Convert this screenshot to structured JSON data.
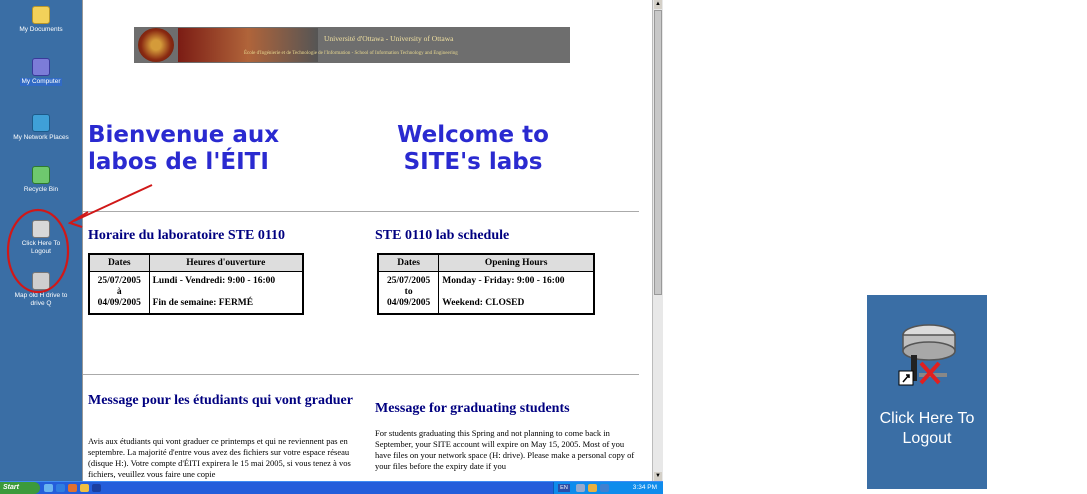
{
  "desktop": {
    "icons": [
      {
        "label": "My Documents"
      },
      {
        "label": "My Computer"
      },
      {
        "label": "My Network Places"
      },
      {
        "label": "Recycle Bin"
      },
      {
        "label": "Click Here To Logout"
      },
      {
        "label": "Map old H drive to drive Q"
      }
    ]
  },
  "banner": {
    "title": "Université d'Ottawa - University of Ottawa",
    "subtitle": "École d'Ingénierie et de Technologie de l'Information - School of Information Technology and Engineering"
  },
  "welcome": {
    "fr_line1": "Bienvenue aux",
    "fr_line2": "labos de l'ÉITI",
    "en_line1": "Welcome to",
    "en_line2": "SITE's labs"
  },
  "schedule_fr": {
    "heading": "Horaire du laboratoire STE 0110",
    "col_dates": "Dates",
    "col_hours": "Heures d'ouverture",
    "date_from": "25/07/2005",
    "date_sep": "à",
    "date_to": "04/09/2005",
    "hours_week": "Lundi - Vendredi: 9:00 - 16:00",
    "hours_weekend": "Fin de semaine: FERMÉ"
  },
  "schedule_en": {
    "heading": "STE 0110 lab schedule",
    "col_dates": "Dates",
    "col_hours": "Opening Hours",
    "date_from": "25/07/2005",
    "date_sep": "to",
    "date_to": "04/09/2005",
    "hours_week": "Monday - Friday: 9:00 - 16:00",
    "hours_weekend": "Weekend: CLOSED"
  },
  "graduating_fr": {
    "heading": "Message pour les étudiants qui vont graduer",
    "body": "Avis aux étudiants qui vont graduer ce printemps et qui ne reviennent pas en septembre. La majorité d'entre vous avez des fichiers sur votre espace réseau (disque H:). Votre compte d'ÉITI expirera le 15 mai 2005, si vous tenez à vos fichiers, veuillez vous faire une copie"
  },
  "graduating_en": {
    "heading": "Message for graduating students",
    "body": "For students graduating this Spring and not planning to come back in September, your SITE account will expire on May 15, 2005. Most of you have files on your network space (H: drive). Please make a personal copy of your files before the expiry date if you"
  },
  "taskbar": {
    "start_label": "Start",
    "clock": "3:34 PM",
    "tray_lang": "EN"
  },
  "zoom_callout": {
    "label_line1": "Click Here To",
    "label_line2": "Logout"
  },
  "colors": {
    "desktop": "#3a6ea5",
    "welcome_text": "#2a2ad0",
    "heading_text": "#000080",
    "annotation": "#d01818"
  }
}
